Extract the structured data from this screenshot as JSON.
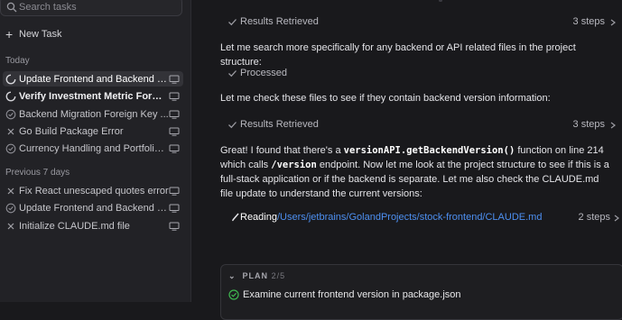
{
  "sidebar": {
    "search_placeholder": "Search tasks",
    "new_task_label": "New Task",
    "sections": [
      {
        "label": "Today",
        "items": [
          {
            "label": "Update Frontend and Backend V...",
            "status": "running",
            "selected": true,
            "bold": false
          },
          {
            "label": "Verify Investment Metric Formulas",
            "status": "running",
            "selected": false,
            "bold": true
          },
          {
            "label": "Backend Migration Foreign Key ...",
            "status": "done",
            "selected": false,
            "bold": false
          },
          {
            "label": "Go Build Package Error",
            "status": "cancelled",
            "selected": false,
            "bold": false
          },
          {
            "label": "Currency Handling and Portfolio ...",
            "status": "done",
            "selected": false,
            "bold": false
          }
        ]
      },
      {
        "label": "Previous 7 days",
        "items": [
          {
            "label": "Fix React unescaped quotes error",
            "status": "cancelled",
            "selected": false,
            "bold": false
          },
          {
            "label": "Update Frontend and Backend V...",
            "status": "done",
            "selected": false,
            "bold": false
          },
          {
            "label": "Initialize CLAUDE.md file",
            "status": "cancelled",
            "selected": false,
            "bold": false
          }
        ]
      }
    ]
  },
  "main": {
    "step1": {
      "label": "Results Retrieved",
      "count": "3 steps"
    },
    "para1": "Let me search more specifically for any backend or API related files in the project structure:",
    "step2": {
      "label": "Processed"
    },
    "para2": "Let me check these files to see if they contain backend version information:",
    "step3": {
      "label": "Results Retrieved",
      "count": "3 steps"
    },
    "para3": {
      "t1": "Great! I found that there's a ",
      "code1": "versionAPI.getBackendVersion()",
      "t2": " function on line 214 which calls ",
      "code2": "/version",
      "t3": " endpoint. Now let me look at the project structure to see if this is a full-stack application or if the backend is separate. Let me also check the CLAUDE.md file update to understand the current versions:"
    },
    "reading": {
      "label": "Reading",
      "path": "/Users/jetbrains/GolandProjects/stock-frontend/CLAUDE.md",
      "count": "2 steps"
    },
    "plan": {
      "header": "PLAN",
      "progress": "2/5",
      "first_item": "Examine current frontend version in package.json"
    }
  },
  "icons": {
    "search": "search-icon",
    "plus": "plus-icon",
    "running": "spinner-icon",
    "done": "check-circle-icon",
    "cancelled": "x-icon",
    "monitor": "monitor-icon",
    "check": "check-icon",
    "chevron": "chevron-icon",
    "pencil": "pencil-icon"
  },
  "colors": {
    "accent_link": "#4d8ff0",
    "success": "#3fb950",
    "selected_bg": "#333338"
  }
}
